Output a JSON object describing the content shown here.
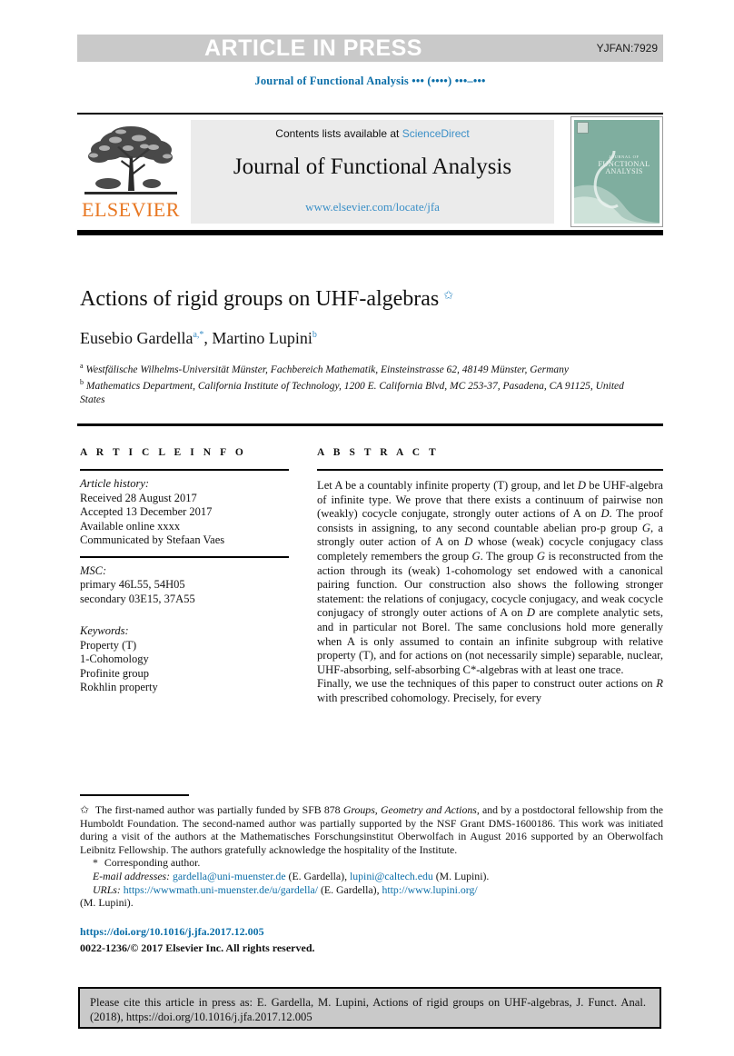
{
  "banner": {
    "press_label": "ARTICLE IN PRESS",
    "article_code": "YJFAN:7929",
    "background_color": "#c9c9c9"
  },
  "journal_ref": "Journal of Functional Analysis ••• (••••) •••–•••",
  "masthead": {
    "contents_prefix": "Contents lists available at ",
    "sciencedirect": "ScienceDirect",
    "journal_title": "Journal of Functional Analysis",
    "journal_url": "www.elsevier.com/locate/jfa",
    "publisher": "ELSEVIER",
    "publisher_color": "#E87722",
    "cover": {
      "line1": "JOURNAL OF",
      "line2": "FUNCTIONAL",
      "line3": "ANALYSIS",
      "background_color": "#7fae9f"
    }
  },
  "article": {
    "title": "Actions of rigid groups on UHF-algebras",
    "title_footnote_symbol": "✩",
    "authors": [
      {
        "name": "Eusebio Gardella",
        "marks": "a,*"
      },
      {
        "name": "Martino Lupini",
        "marks": "b"
      }
    ],
    "affiliations": [
      {
        "mark": "a",
        "text": "Westfälische Wilhelms-Universität Münster, Fachbereich Mathematik, Einsteinstrasse 62, 48149 Münster, Germany"
      },
      {
        "mark": "b",
        "text": "Mathematics Department, California Institute of Technology, 1200 E. California Blvd, MC 253-37, Pasadena, CA 91125, United States"
      }
    ]
  },
  "info": {
    "heading": "A R T I C L E   I N F O",
    "history_label": "Article history:",
    "history": [
      "Received 28 August 2017",
      "Accepted 13 December 2017",
      "Available online xxxx",
      "Communicated by Stefaan Vaes"
    ],
    "msc_label": "MSC:",
    "msc": [
      "primary 46L55, 54H05",
      "secondary 03E15, 37A55"
    ],
    "keywords_label": "Keywords:",
    "keywords": [
      "Property (T)",
      "1-Cohomology",
      "Profinite group",
      "Rokhlin property"
    ]
  },
  "abstract": {
    "heading": "A B S T R A C T",
    "paragraph1_a": "Let A be a countably infinite property (T) group, and let ",
    "paragraph1_b": "D",
    "paragraph1_c": " be UHF-algebra of infinite type. We prove that there exists a continuum of pairwise non (weakly) cocycle conjugate, strongly outer actions of A on ",
    "paragraph1_d": "D",
    "paragraph1_e": ". The proof consists in assigning, to any second countable abelian pro-p group ",
    "paragraph1_f": "G",
    "paragraph1_g": ", a strongly outer action of A on ",
    "paragraph1_h": "D",
    "paragraph1_i": " whose (weak) cocycle conjugacy class completely remembers the group ",
    "paragraph1_j": "G",
    "paragraph1_k": ". The group ",
    "paragraph1_l": "G",
    "paragraph1_m": " is reconstructed from the action through its (weak) 1-cohomology set endowed with a canonical pairing function. Our construction also shows the following stronger statement: the relations of conjugacy, cocycle conjugacy, and weak cocycle conjugacy of strongly outer actions of A on ",
    "paragraph1_n": "D",
    "paragraph1_o": " are complete analytic sets, and in particular not Borel. The same conclusions hold more generally when A is only assumed to contain an infinite subgroup with relative property (T), and for actions on (not necessarily simple) separable, nuclear, UHF-absorbing, self-absorbing C*-algebras with at least one trace.",
    "paragraph2_a": "Finally, we use the techniques of this paper to construct outer actions on ",
    "paragraph2_b": "R",
    "paragraph2_c": " with prescribed cohomology. Precisely, for every"
  },
  "footnotes": {
    "funding_symbol": "✩",
    "funding_a": " The first-named author was partially funded by SFB 878 ",
    "funding_b": "Groups, Geometry and Actions",
    "funding_c": ", and by a postdoctoral fellowship from the Humboldt Foundation. The second-named author was partially supported by the NSF Grant DMS-1600186. This work was initiated during a visit of the authors at the Mathematisches Forschungsinstitut Oberwolfach in August 2016 supported by an Oberwolfach Leibnitz Fellowship. The authors gratefully acknowledge the hospitality of the Institute.",
    "corresponding_symbol": "*",
    "corresponding": " Corresponding author.",
    "email_label": "E-mail addresses:",
    "email1": "gardella@uni-muenster.de",
    "email1_owner": " (E. Gardella), ",
    "email2": "lupini@caltech.edu",
    "email2_owner": " (M. Lupini).",
    "urls_label": "URLs:",
    "url1": "https://wwwmath.uni-muenster.de/u/gardella/",
    "url1_owner": " (E. Gardella), ",
    "url2": "http://www.lupini.org/",
    "url2_owner": "(M. Lupini).",
    "doi": "https://doi.org/10.1016/j.jfa.2017.12.005",
    "copyright": "0022-1236/© 2017 Elsevier Inc. All rights reserved."
  },
  "cite_box": {
    "text": "Please cite this article in press as: E. Gardella, M. Lupini, Actions of rigid groups on UHF-algebras, J. Funct. Anal. (2018), https://doi.org/10.1016/j.jfa.2017.12.005"
  }
}
